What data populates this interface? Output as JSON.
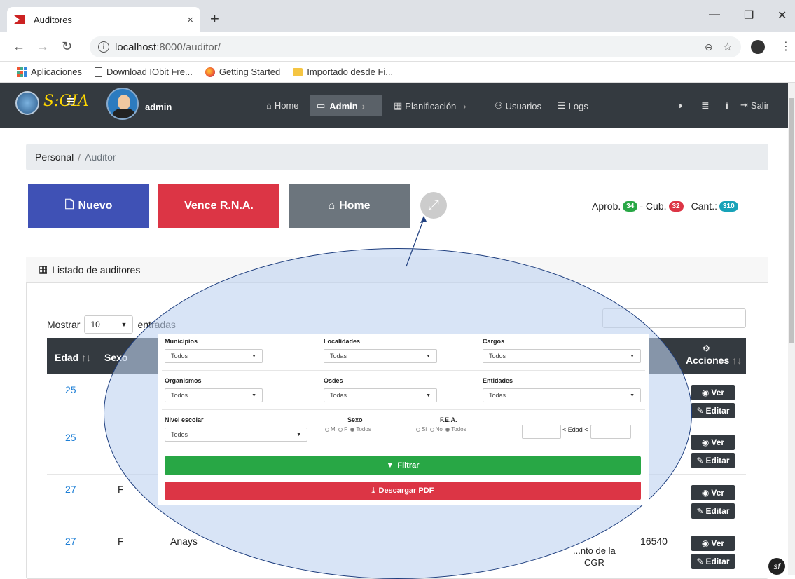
{
  "browser": {
    "tab_title": "Auditores",
    "tab_close": "×",
    "new_tab": "+",
    "window_controls": [
      "—",
      "❐",
      "✕"
    ],
    "url_host": "localhost",
    "url_rest": ":8000/auditor/",
    "bookmarks": [
      "Aplicaciones",
      "Download IObit Fre...",
      "Getting Started",
      "Importado desde Fi..."
    ]
  },
  "navbar": {
    "brand": "S:GIA",
    "username": "admin",
    "items": {
      "home": "Home",
      "admin": "Admin",
      "planificacion": "Planificación",
      "usuarios": "Usuarios",
      "logs": "Logs",
      "salir": "Salir"
    }
  },
  "breadcrumb": {
    "parent": "Personal",
    "separator": "/",
    "current": "Auditor"
  },
  "buttons": {
    "nuevo": "Nuevo",
    "vence": "Vence R.N.A.",
    "home": "Home"
  },
  "stats": {
    "aprob_label": "Aprob.",
    "aprob_count": "34",
    "dash": "- Cub.",
    "cub_count": "32",
    "cant_label": "Cant.:",
    "cant_count": "310"
  },
  "card": {
    "title": "Listado de auditores"
  },
  "table": {
    "show_label": "Mostrar",
    "show_value": "10",
    "entries_label": "entradas",
    "headers": {
      "edad": "Edad",
      "sexo": "Sexo",
      "acciones": "Acciones"
    },
    "rows": [
      {
        "edad": "25",
        "sexo": "",
        "nombre": ""
      },
      {
        "edad": "25",
        "sexo": "",
        "nombre": ""
      },
      {
        "edad": "27",
        "sexo": "F",
        "nombre": ""
      },
      {
        "edad": "27",
        "sexo": "F",
        "nombre": "Anays",
        "entidad_1": "...nto de la",
        "entidad_2": "CGR",
        "codigo": "16540"
      }
    ],
    "ver": "Ver",
    "editar": "Editar"
  },
  "filters": {
    "municipios": {
      "label": "Municipios",
      "value": "Todos"
    },
    "localidades": {
      "label": "Localidades",
      "value": "Todas"
    },
    "cargos": {
      "label": "Cargos",
      "value": "Todos"
    },
    "organismos": {
      "label": "Organismos",
      "value": "Todos"
    },
    "osdes": {
      "label": "Osdes",
      "value": "Todas"
    },
    "entidades": {
      "label": "Entidades",
      "value": "Todas"
    },
    "nivel": {
      "label": "Nivel escolar",
      "value": "Todos"
    },
    "sexo": {
      "label": "Sexo",
      "opt1": "M",
      "opt2": "F",
      "opt3": "Todos"
    },
    "fea": {
      "label": "F.E.A.",
      "opt1": "Si",
      "opt2": "No",
      "opt3": "Todos"
    },
    "edad": {
      "label": "< Edad <"
    },
    "filtrar": "Filtrar",
    "descargar": "Descargar PDF"
  }
}
